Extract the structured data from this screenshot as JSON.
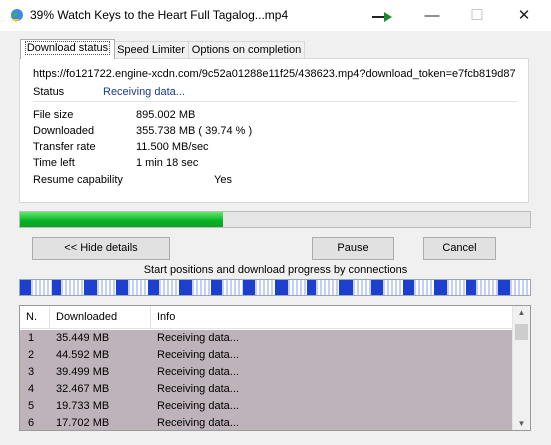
{
  "window": {
    "title": "39% Watch Keys to the Heart Full Tagalog...mp4",
    "minimize": "—",
    "maximize": "☐",
    "close": "✕"
  },
  "tabs": [
    {
      "label": "Download status",
      "active": true
    },
    {
      "label": "Speed Limiter",
      "active": false
    },
    {
      "label": "Options on completion",
      "active": false
    }
  ],
  "status": {
    "url": "https://fo121722.engine-xcdn.com/9c52a01288e11f25/438623.mp4?download_token=e7fcb819d87",
    "status_label": "Status",
    "status_value": "Receiving data...",
    "file_size_label": "File size",
    "file_size": "895.002  MB",
    "downloaded_label": "Downloaded",
    "downloaded": "355.738  MB  ( 39.74 % )",
    "transfer_rate_label": "Transfer rate",
    "transfer_rate": "11.500  MB/sec",
    "time_left_label": "Time left",
    "time_left": "1 min 18 sec",
    "resume_label": "Resume capability",
    "resume": "Yes"
  },
  "progress": {
    "fraction": 0.3974,
    "color": "#06b025"
  },
  "buttons": {
    "hide_details": "<< Hide details",
    "pause": "Pause",
    "cancel": "Cancel"
  },
  "connections": {
    "label": "Start positions and download progress by connections",
    "progress_color": "#1c3fd0",
    "remaining_color": "#c5d0f5",
    "fill_fractions": [
      0.35,
      0.3,
      0.42,
      0.38,
      0.35,
      0.4,
      0.33,
      0.36,
      0.4,
      0.3,
      0.45,
      0.38,
      0.35,
      0.4,
      0.3,
      0.36
    ]
  },
  "list": {
    "headers": [
      "N.",
      "Downloaded",
      "Info"
    ],
    "rows": [
      {
        "n": "1",
        "downloaded": "35.449  MB",
        "info": "Receiving data..."
      },
      {
        "n": "2",
        "downloaded": "44.592  MB",
        "info": "Receiving data..."
      },
      {
        "n": "3",
        "downloaded": "39.499  MB",
        "info": "Receiving data..."
      },
      {
        "n": "4",
        "downloaded": "32.467  MB",
        "info": "Receiving data..."
      },
      {
        "n": "5",
        "downloaded": "19.733  MB",
        "info": "Receiving data..."
      },
      {
        "n": "6",
        "downloaded": "17.702  MB",
        "info": "Receiving data..."
      }
    ]
  }
}
